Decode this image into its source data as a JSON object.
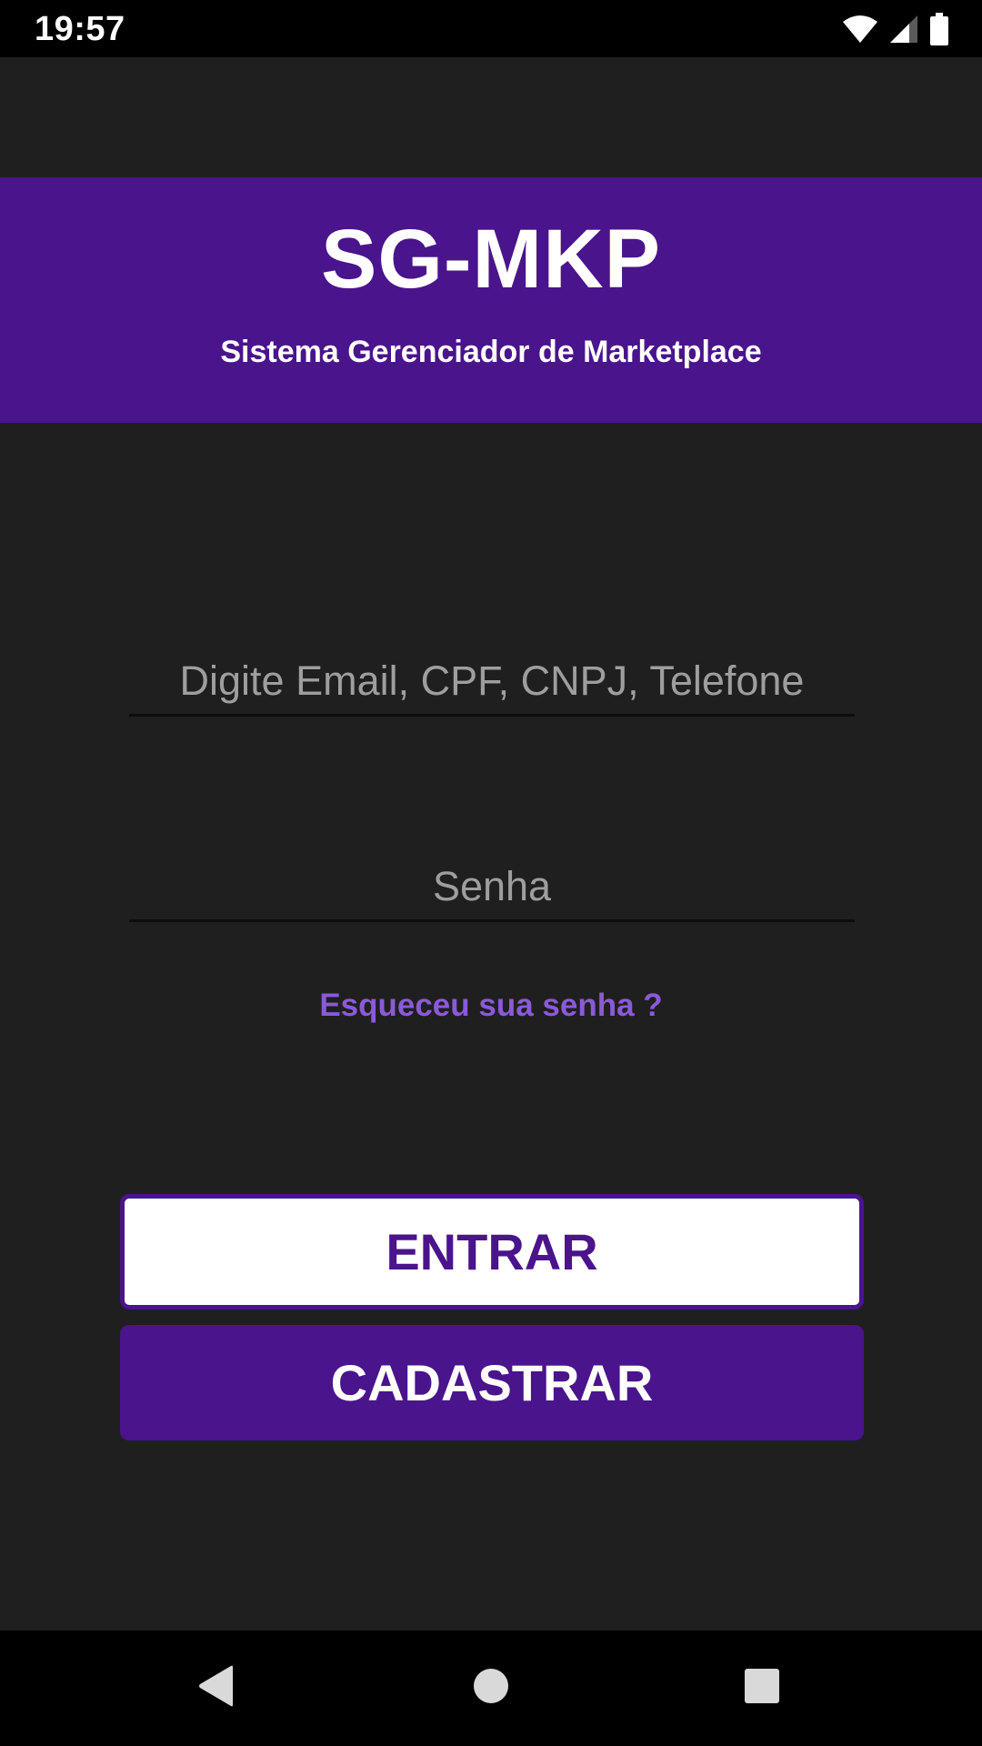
{
  "status_bar": {
    "time": "19:57",
    "icons": [
      "wifi-icon",
      "cell-signal-icon",
      "battery-icon"
    ]
  },
  "header": {
    "title": "SG-MKP",
    "subtitle": "Sistema Gerenciador de Marketplace"
  },
  "login_form": {
    "login_field": {
      "value": "",
      "placeholder": "Digite Email, CPF, CNPJ, Telefone"
    },
    "password_field": {
      "value": "",
      "placeholder": "Senha"
    },
    "forgot_password_label": "Esqueceu sua senha ?",
    "enter_button_label": "ENTRAR",
    "register_button_label": "CADASTRAR"
  },
  "nav_bar": {
    "icons": [
      "back-icon",
      "home-icon",
      "recents-icon"
    ]
  },
  "colors": {
    "background": "#1f1f1f",
    "primary": "#4a148c",
    "link": "#8a5ad8",
    "button_light": "#ffffff"
  }
}
